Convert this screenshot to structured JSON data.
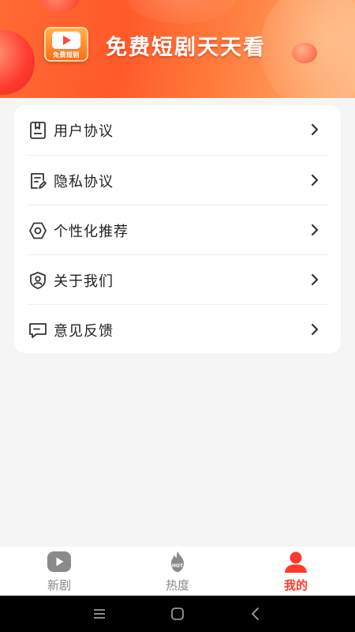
{
  "banner": {
    "logo_text": "免费短剧",
    "title": "免费短剧天天看"
  },
  "menu": {
    "items": [
      {
        "label": "用户协议",
        "icon": "document-icon"
      },
      {
        "label": "隐私协议",
        "icon": "edit-document-icon"
      },
      {
        "label": "个性化推荐",
        "icon": "gear-icon"
      },
      {
        "label": "关于我们",
        "icon": "shield-user-icon"
      },
      {
        "label": "意见反馈",
        "icon": "feedback-message-icon"
      }
    ]
  },
  "tabbar": {
    "tabs": [
      {
        "label": "新剧",
        "icon": "play-icon",
        "active": false
      },
      {
        "label": "热度",
        "icon": "hot-flame-icon",
        "icon_text": "HOT",
        "active": false
      },
      {
        "label": "我的",
        "icon": "user-icon",
        "active": true
      }
    ]
  },
  "system_nav": [
    "menu-icon",
    "home-icon",
    "back-icon"
  ],
  "colors": {
    "accent": "#ff3a2a",
    "banner_start": "#ff5a2a",
    "banner_end": "#ffb37c",
    "inactive_tab": "#888888",
    "background": "#f5f5f5"
  }
}
